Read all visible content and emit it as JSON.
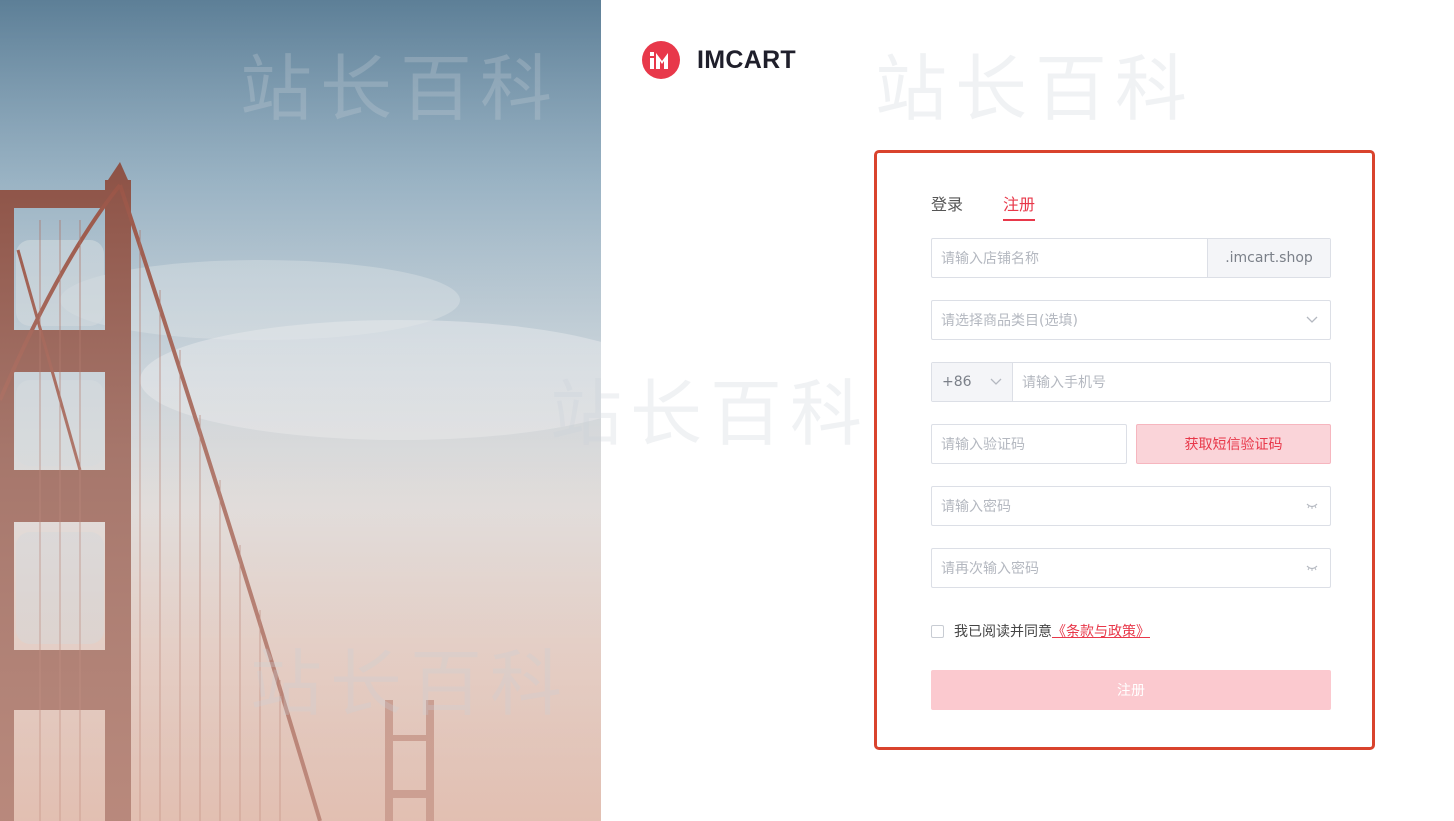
{
  "brand": {
    "name": "IMCART",
    "logo_letters": "iM"
  },
  "watermark": "站长百科",
  "tabs": [
    {
      "label": "登录",
      "active": false
    },
    {
      "label": "注册",
      "active": true
    }
  ],
  "form": {
    "store_name": {
      "placeholder": "请输入店铺名称",
      "suffix": ".imcart.shop"
    },
    "category": {
      "placeholder": "请选择商品类目(选填)"
    },
    "phone": {
      "country_code": "+86",
      "placeholder": "请输入手机号"
    },
    "sms_code": {
      "placeholder": "请输入验证码",
      "button": "获取短信验证码"
    },
    "password": {
      "placeholder": "请输入密码"
    },
    "password_confirm": {
      "placeholder": "请再次输入密码"
    },
    "agreement": {
      "text": "我已阅读并同意",
      "link": "《条款与政策》",
      "checked": false
    },
    "submit": "注册"
  },
  "colors": {
    "accent": "#e8384a",
    "card_border": "#d9432d",
    "button_disabled": "#fbc9cf",
    "sms_button_bg": "#fad4d9"
  },
  "icons": [
    "chevron-down-icon",
    "eye-closed-icon",
    "logo-mark"
  ]
}
